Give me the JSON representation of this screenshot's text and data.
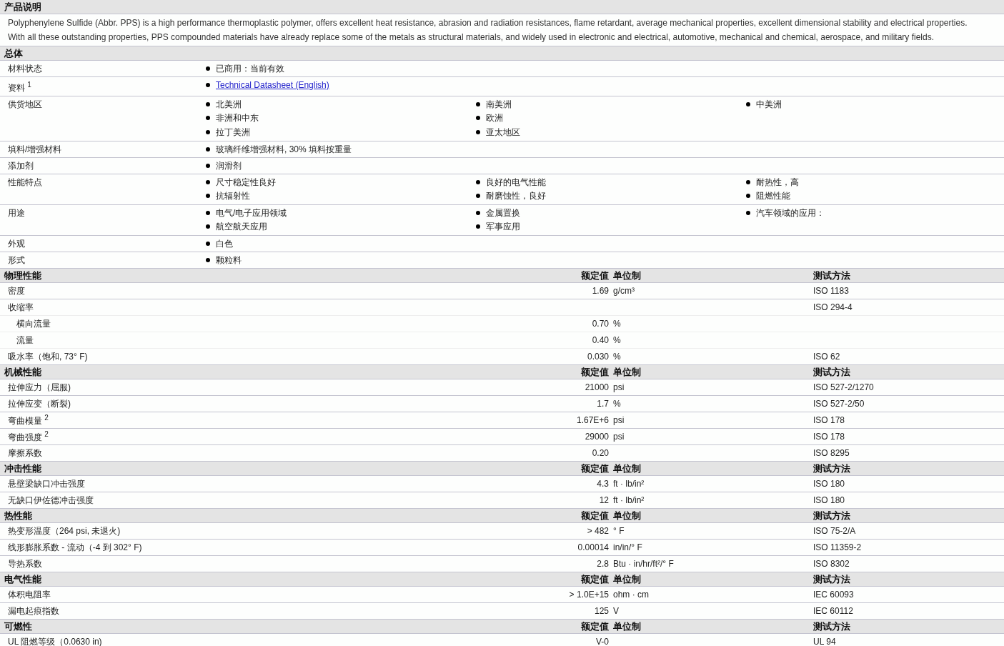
{
  "description": {
    "title": "产品说明",
    "paragraphs": [
      "Polyphenylene Sulfide (Abbr. PPS) is a high performance thermoplastic polymer, offers excellent heat resistance, abrasion and radiation resistances, flame retardant, average mechanical properties, excellent dimensional stability and electrical properties.",
      "With all these outstanding properties, PPS compounded materials have already replace some of the metals as structural materials, and widely used in electronic and electrical, automotive, mechanical and chemical, aerospace, and military fields."
    ]
  },
  "general": {
    "title": "总体",
    "rows": [
      {
        "label": "材料状态",
        "columns": [
          [
            {
              "kind": "text",
              "text": "已商用：当前有效"
            }
          ]
        ]
      },
      {
        "label": "资料 $^{1}$",
        "columns": [
          [
            {
              "kind": "link",
              "text": "Technical Datasheet (English)"
            }
          ]
        ]
      },
      {
        "label": "供货地区",
        "columns": [
          [
            {
              "kind": "text",
              "text": "北美洲"
            },
            {
              "kind": "text",
              "text": "非洲和中东"
            },
            {
              "kind": "text",
              "text": "拉丁美洲"
            }
          ],
          [
            {
              "kind": "text",
              "text": "南美洲"
            },
            {
              "kind": "text",
              "text": "欧洲"
            },
            {
              "kind": "text",
              "text": "亚太地区"
            }
          ],
          [
            {
              "kind": "text",
              "text": "中美洲"
            }
          ]
        ]
      },
      {
        "label": "填料/增强材料",
        "columns": [
          [
            {
              "kind": "text",
              "text": "玻璃纤维增强材料, 30% 填料按重量"
            }
          ]
        ]
      },
      {
        "label": "添加剂",
        "columns": [
          [
            {
              "kind": "text",
              "text": "润滑剂"
            }
          ]
        ]
      },
      {
        "label": "性能特点",
        "columns": [
          [
            {
              "kind": "text",
              "text": "尺寸稳定性良好"
            },
            {
              "kind": "text",
              "text": "抗辐射性"
            }
          ],
          [
            {
              "kind": "text",
              "text": "良好的电气性能"
            },
            {
              "kind": "text",
              "text": "耐磨蚀性，良好"
            }
          ],
          [
            {
              "kind": "text",
              "text": "耐热性，高"
            },
            {
              "kind": "text",
              "text": "阻燃性能"
            }
          ]
        ]
      },
      {
        "label": "用途",
        "columns": [
          [
            {
              "kind": "text",
              "text": "电气/电子应用领域"
            },
            {
              "kind": "text",
              "text": "航空航天应用"
            }
          ],
          [
            {
              "kind": "text",
              "text": "金属置换"
            },
            {
              "kind": "text",
              "text": "军事应用"
            }
          ],
          [
            {
              "kind": "text",
              "text": "汽车领域的应用："
            }
          ]
        ]
      },
      {
        "label": "外观",
        "columns": [
          [
            {
              "kind": "text",
              "text": "白色"
            }
          ]
        ]
      },
      {
        "label": "形式",
        "columns": [
          [
            {
              "kind": "text",
              "text": "颗粒料"
            }
          ]
        ]
      }
    ]
  },
  "sections": [
    {
      "title": "物理性能",
      "headers": {
        "value": "额定值",
        "unit": "单位制",
        "method": "测试方法"
      },
      "rows": [
        {
          "label": "密度",
          "value": "1.69",
          "unit": "g/cm³",
          "method": "ISO 1183"
        },
        {
          "label": "收缩率",
          "method": "ISO 294-4",
          "children": [
            {
              "label": "横向流量",
              "value": "0.70",
              "unit": "%"
            },
            {
              "label": "流量",
              "value": "0.40",
              "unit": "%"
            }
          ]
        },
        {
          "label": "吸水率（饱和, 73° F)",
          "value": "0.030",
          "unit": "%",
          "method": "ISO 62"
        }
      ]
    },
    {
      "title": "机械性能",
      "headers": {
        "value": "额定值",
        "unit": "单位制",
        "method": "测试方法"
      },
      "rows": [
        {
          "label": "拉伸应力（屈服)",
          "value": "21000",
          "unit": "psi",
          "method": "ISO 527-2/1270"
        },
        {
          "label": "拉伸应变（断裂)",
          "value": "1.7",
          "unit": "%",
          "method": "ISO 527-2/50"
        },
        {
          "label": "弯曲模量 $^{2}$",
          "value": "1.67E+6",
          "unit": "psi",
          "method": "ISO 178"
        },
        {
          "label": "弯曲强度 $^{2}$",
          "value": "29000",
          "unit": "psi",
          "method": "ISO 178"
        },
        {
          "label": "摩擦系数",
          "value": "0.20",
          "method": "ISO 8295"
        }
      ]
    },
    {
      "title": "冲击性能",
      "headers": {
        "value": "额定值",
        "unit": "单位制",
        "method": "测试方法"
      },
      "rows": [
        {
          "label": "悬壁梁缺口冲击强度",
          "value": "4.3",
          "unit": "ft · lb/in²",
          "method": "ISO 180"
        },
        {
          "label": "无缺口伊佐德冲击强度",
          "value": "12",
          "unit": "ft · lb/in²",
          "method": "ISO 180"
        }
      ]
    },
    {
      "title": "热性能",
      "headers": {
        "value": "额定值",
        "unit": "单位制",
        "method": "测试方法"
      },
      "rows": [
        {
          "label": "热变形温度（264 psi, 未退火)",
          "value": "> 482",
          "unit": "° F",
          "method": "ISO 75-2/A"
        },
        {
          "label": "线形膨胀系数 - 流动（-4 到 302° F)",
          "value": "0.00014",
          "unit": "in/in/° F",
          "method": "ISO 11359-2"
        },
        {
          "label": "导热系数",
          "value": "2.8",
          "unit": "Btu · in/hr/ft²/° F",
          "method": "ISO 8302"
        }
      ]
    },
    {
      "title": "电气性能",
      "headers": {
        "value": "额定值",
        "unit": "单位制",
        "method": "测试方法"
      },
      "rows": [
        {
          "label": "体积电阻率",
          "value": "> 1.0E+15",
          "unit": "ohm · cm",
          "method": "IEC 60093"
        },
        {
          "label": "漏电起痕指数",
          "value": "125",
          "unit": "V",
          "method": "IEC 60112"
        }
      ]
    },
    {
      "title": "可燃性",
      "headers": {
        "value": "额定值",
        "unit": "单位制",
        "method": "测试方法"
      },
      "rows": [
        {
          "label": "UL 阻燃等级（0.0630 in)",
          "value": "V-0",
          "method": "UL 94"
        }
      ]
    }
  ]
}
